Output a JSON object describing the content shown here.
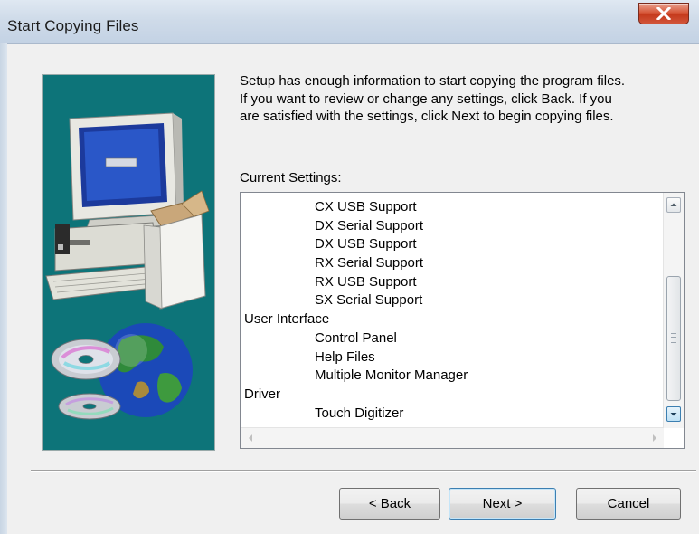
{
  "window": {
    "title": "Start Copying Files",
    "close_symbol": "×"
  },
  "intro": {
    "line1": "Setup has enough information to start copying the program files.",
    "line2": "If you want to review or change any settings, click Back.  If you",
    "line3": "are satisfied with the settings, click Next to begin copying files."
  },
  "settings": {
    "label": "Current Settings:",
    "items": [
      {
        "text": "CX USB Support",
        "indent": true
      },
      {
        "text": "DX Serial Support",
        "indent": true
      },
      {
        "text": "DX USB Support",
        "indent": true
      },
      {
        "text": "RX Serial Support",
        "indent": true
      },
      {
        "text": "RX USB Support",
        "indent": true
      },
      {
        "text": "SX Serial Support",
        "indent": true
      },
      {
        "text": "User Interface",
        "indent": false
      },
      {
        "text": "Control Panel",
        "indent": true
      },
      {
        "text": "Help Files",
        "indent": true
      },
      {
        "text": "Multiple Monitor Manager",
        "indent": true
      },
      {
        "text": "Driver",
        "indent": false
      },
      {
        "text": "Touch Digitizer",
        "indent": true
      }
    ]
  },
  "buttons": {
    "back": "< Back",
    "next": "Next >",
    "cancel": "Cancel"
  },
  "icons": {
    "close": "close-icon",
    "artwork": "computer-and-globe-illustration",
    "scroll_up": "chevron-up-icon",
    "scroll_down": "chevron-down-icon",
    "scroll_left": "chevron-left-icon",
    "scroll_right": "chevron-right-icon"
  },
  "colors": {
    "art_background": "#0d7479",
    "close_button": "#c53a1c",
    "default_button_border": "#3c7fb1"
  }
}
